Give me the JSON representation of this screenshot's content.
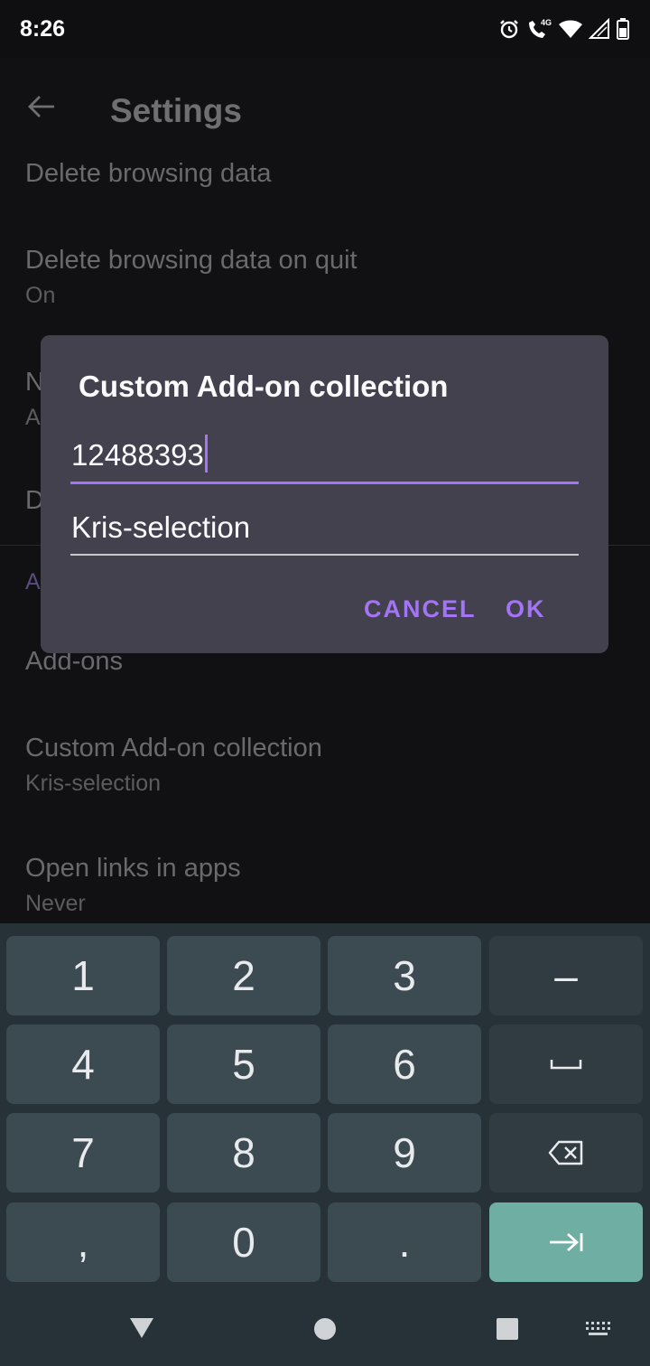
{
  "status_bar": {
    "time": "8:26",
    "network": "4G"
  },
  "app_bar": {
    "title": "Settings"
  },
  "settings": {
    "delete_browsing_data": "Delete browsing data",
    "delete_on_quit_title": "Delete browsing data on quit",
    "delete_on_quit_summary": "On",
    "partial_item_1_title": "N",
    "partial_item_1_summary": "A",
    "partial_item_2_title": "D",
    "section_header_partial": "A",
    "addons": "Add-ons",
    "custom_collection_title": "Custom Add-on collection",
    "custom_collection_summary": "Kris-selection",
    "open_links_title": "Open links in apps",
    "open_links_summary": "Never"
  },
  "dialog": {
    "title": "Custom Add-on collection",
    "field_user_value": "12488393",
    "field_collection_value": "Kris-selection",
    "cancel_label": "CANCEL",
    "ok_label": "OK"
  },
  "keyboard": {
    "rows": [
      [
        "1",
        "2",
        "3",
        "–"
      ],
      [
        "4",
        "5",
        "6",
        "space-icon"
      ],
      [
        "7",
        "8",
        "9",
        "backspace-icon"
      ],
      [
        ",",
        "0",
        ".",
        "tab-forward-icon"
      ]
    ]
  },
  "colors": {
    "accent": "#a374f5",
    "dialog_bg": "#42414d",
    "keyboard_bg": "#263238",
    "key_bg": "#3c4a51",
    "enter_key_bg": "#6eaea3"
  }
}
